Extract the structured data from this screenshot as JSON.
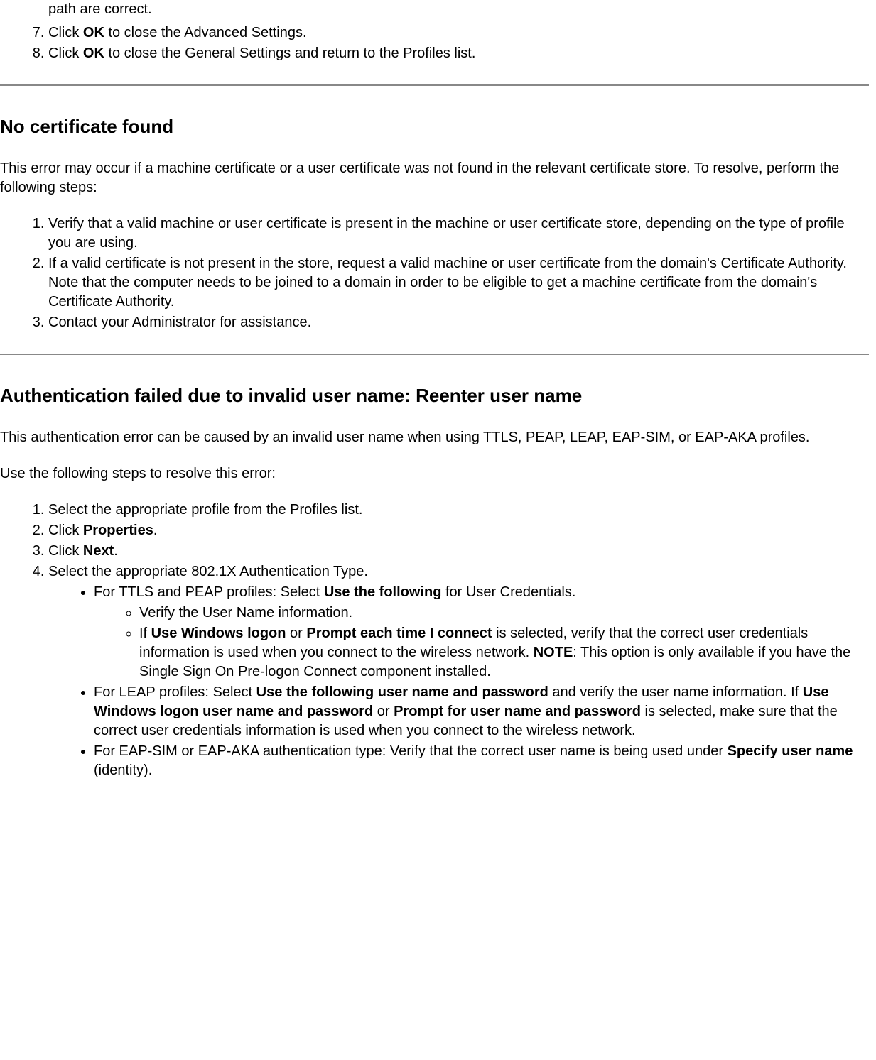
{
  "fragment": {
    "trail": "path are correct.",
    "item7_prefix": "Click ",
    "item7_b": "OK",
    "item7_suffix": " to close the Advanced Settings.",
    "item8_prefix": "Click ",
    "item8_b": "OK",
    "item8_suffix": " to close the General Settings and return to the Profiles list."
  },
  "sec2": {
    "title": "No certificate found",
    "intro": "This error may occur if a machine certificate or a user certificate was not found in the relevant certificate store. To resolve, perform the following steps:",
    "steps": {
      "s1": "Verify that a valid machine or user certificate is present in the machine or user certificate store, depending on the type of profile you are using.",
      "s2": "If a valid certificate is not present in the store, request a valid machine or user certificate from the domain's Certificate Authority. Note that the computer needs to be joined to a domain in order to be eligible to get a machine certificate from the domain's Certificate Authority.",
      "s3": "Contact your Administrator for assistance."
    }
  },
  "sec3": {
    "title": "Authentication failed due to invalid user name: Reenter user name",
    "intro1": "This authentication error can be caused by an invalid user name when using TTLS, PEAP, LEAP, EAP-SIM, or EAP-AKA profiles.",
    "intro2": "Use the following steps to resolve this error:",
    "s1": "Select the appropriate profile from the Profiles list.",
    "s2_prefix": "Click ",
    "s2_b": "Properties",
    "s2_suffix": ".",
    "s3_prefix": "Click ",
    "s3_b": "Next",
    "s3_suffix": ".",
    "s4": "Select the appropriate 802.1X Authentication Type.",
    "b1_prefix": "For TTLS and PEAP profiles: Select ",
    "b1_b": "Use the following",
    "b1_suffix": " for User Credentials.",
    "b1a": "Verify the User Name information.",
    "b1b_p1": "If ",
    "b1b_b1": "Use Windows logon",
    "b1b_p2": " or ",
    "b1b_b2": "Prompt each time I connect",
    "b1b_p3": " is selected, verify that the correct user credentials information is used when you connect to the wireless network. ",
    "b1b_b3": "NOTE",
    "b1b_p4": ": This option is only available if you have the Single Sign On Pre-logon Connect component installed.",
    "b2_p1": "For LEAP profiles: Select ",
    "b2_b1": "Use the following user name and password",
    "b2_p2": " and verify the user name information. If ",
    "b2_b2": "Use Windows logon user name and password",
    "b2_p3": " or ",
    "b2_b3": "Prompt for user name and password",
    "b2_p4": " is selected, make sure that the correct user credentials information is used when you connect to the wireless network.",
    "b3_p1": "For EAP-SIM or EAP-AKA authentication type: Verify that the correct user name is being used under ",
    "b3_b1": "Specify user name",
    "b3_p2": " (identity)."
  }
}
